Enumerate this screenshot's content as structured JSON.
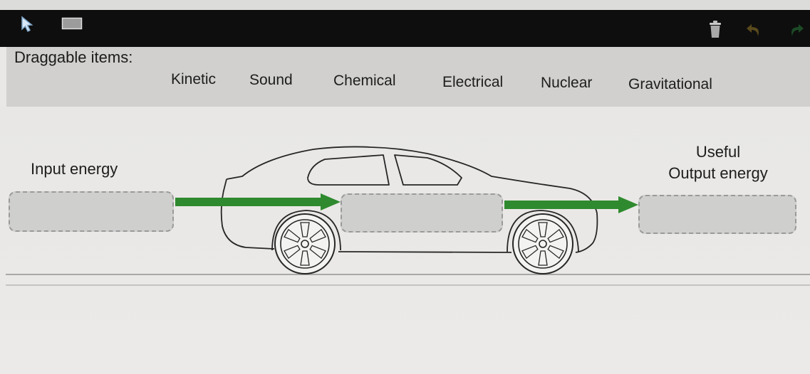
{
  "toolbar": {
    "icons": [
      "pointer-icon",
      "rectangle-icon",
      "trash-icon",
      "undo-icon",
      "redo-icon"
    ],
    "background": "#0e0e0e"
  },
  "bank": {
    "title": "Draggable items:",
    "items": [
      "Kinetic",
      "Sound",
      "Chemical",
      "Electrical",
      "Nuclear",
      "Gravitational"
    ]
  },
  "diagram": {
    "input_label": "Input energy",
    "output_label_line1": "Useful",
    "output_label_line2": "Output energy",
    "arrow_color": "#2f8a2f",
    "drop_zone_color": "#cfcfcd"
  }
}
